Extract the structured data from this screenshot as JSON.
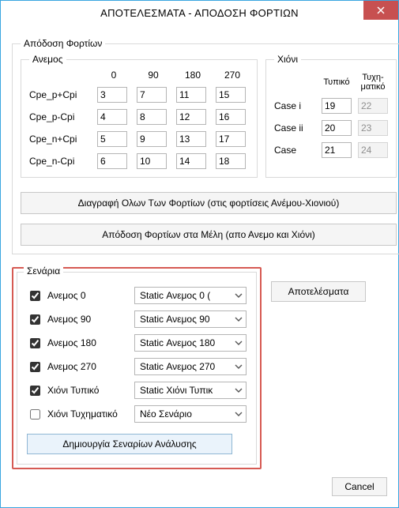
{
  "window": {
    "title": "ΑΠΟΤΕΛΕΣΜΑΤΑ - ΑΠΟΔΟΣΗ ΦΟΡΤΙΩΝ"
  },
  "load_release": {
    "legend": "Απόδοση Φορτίων",
    "wind": {
      "legend": "Ανεμος",
      "angles": [
        "0",
        "90",
        "180",
        "270"
      ],
      "rows": [
        {
          "label": "Cpe_p+Cpi",
          "v": [
            "3",
            "7",
            "11",
            "15"
          ]
        },
        {
          "label": "Cpe_p-Cpi",
          "v": [
            "4",
            "8",
            "12",
            "16"
          ]
        },
        {
          "label": "Cpe_n+Cpi",
          "v": [
            "5",
            "9",
            "13",
            "17"
          ]
        },
        {
          "label": "Cpe_n-Cpi",
          "v": [
            "6",
            "10",
            "14",
            "18"
          ]
        }
      ]
    },
    "snow": {
      "legend": "Χιόνι",
      "headers": {
        "typical": "Τυπικό",
        "random_line1": "Τυχη-",
        "random_line2": "ματικό"
      },
      "rows": [
        {
          "label": "Case i",
          "typical": "19",
          "random": "22",
          "random_disabled": true
        },
        {
          "label": "Case ii",
          "typical": "20",
          "random": "23",
          "random_disabled": true
        },
        {
          "label": "Case",
          "typical": "21",
          "random": "24",
          "random_disabled": true
        }
      ]
    },
    "buttons": {
      "delete_all": "Διαγραφή Ολων Των Φορτίων (στις φορτίσεις Ανέμου-Χιονιού)",
      "assign_members": "Απόδοση Φορτίων στα Μέλη (απο Ανεμο και Χιόνι)"
    }
  },
  "scenarios": {
    "legend": "Σενάρια",
    "items": [
      {
        "checked": true,
        "label": "Ανεμος 0",
        "scenario": "Static Ανεμος 0 ("
      },
      {
        "checked": true,
        "label": "Ανεμος 90",
        "scenario": "Static Ανεμος 90"
      },
      {
        "checked": true,
        "label": "Ανεμος 180",
        "scenario": "Static Ανεμος 180"
      },
      {
        "checked": true,
        "label": "Ανεμος 270",
        "scenario": "Static Ανεμος 270"
      },
      {
        "checked": true,
        "label": "Χιόνι Τυπικό",
        "scenario": "Static Χιόνι Τυπικ"
      },
      {
        "checked": false,
        "label": "Χιόνι Τυχηματικό",
        "scenario": "Νέο Σενάριο"
      }
    ],
    "create_button": "Δημιουργία Σεναρίων Ανάλυσης"
  },
  "right": {
    "results": "Αποτελέσματα",
    "cancel": "Cancel"
  }
}
